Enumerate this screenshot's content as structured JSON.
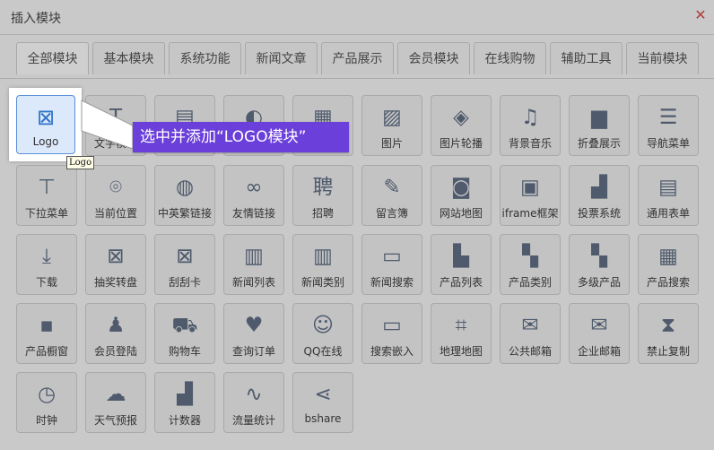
{
  "dialog": {
    "title": "插入模块",
    "close_icon": "close-icon"
  },
  "tabs": [
    "全部模块",
    "基本模块",
    "系统功能",
    "新闻文章",
    "产品展示",
    "会员模块",
    "在线购物",
    "辅助工具",
    "当前模块"
  ],
  "active_tab": "全部模块",
  "highlighted_module": {
    "label": "Logo",
    "icon": "logo-icon",
    "tooltip": "Logo"
  },
  "callout": {
    "text": "选中并添加“LOGO模块”",
    "color": "#6b3fd9"
  },
  "rows": [
    [
      {
        "label": "文字模块",
        "icon": "text-icon",
        "glyph": "T"
      },
      {
        "label": "",
        "icon": "image-text-icon",
        "glyph": "▤"
      },
      {
        "label": "",
        "icon": "flash-icon",
        "glyph": "◐"
      },
      {
        "label": "",
        "icon": "video-icon",
        "glyph": "▦"
      },
      {
        "label": "图片",
        "icon": "image-icon",
        "glyph": "▨"
      },
      {
        "label": "图片轮播",
        "icon": "slideshow-icon",
        "glyph": "◈"
      },
      {
        "label": "背景音乐",
        "icon": "music-icon",
        "glyph": "♫"
      },
      {
        "label": "折叠展示",
        "icon": "folder-icon",
        "glyph": "▆"
      },
      {
        "label": "导航菜单",
        "icon": "menu-icon",
        "glyph": "☰"
      }
    ],
    [
      {
        "label": "下拉菜单",
        "icon": "sitemap-icon",
        "glyph": "⊤"
      },
      {
        "label": "当前位置",
        "icon": "location-pin-icon",
        "glyph": "⌾"
      },
      {
        "label": "中英繁链接",
        "icon": "globe-icon",
        "glyph": "◍"
      },
      {
        "label": "友情链接",
        "icon": "link-icon",
        "glyph": "∞"
      },
      {
        "label": "招聘",
        "icon": "recruit-icon",
        "glyph": "聘"
      },
      {
        "label": "留言簿",
        "icon": "pencil-icon",
        "glyph": "✎"
      },
      {
        "label": "网站地图",
        "icon": "site-map-icon",
        "glyph": "◙"
      },
      {
        "label": "iframe框架",
        "icon": "iframe-icon",
        "glyph": "▣"
      },
      {
        "label": "投票系统",
        "icon": "vote-chart-icon",
        "glyph": "▟"
      },
      {
        "label": "通用表单",
        "icon": "form-icon",
        "glyph": "▤"
      }
    ],
    [
      {
        "label": "下载",
        "icon": "download-icon",
        "glyph": "⤓"
      },
      {
        "label": "抽奖转盘",
        "icon": "lottery-icon",
        "glyph": "⊠"
      },
      {
        "label": "刮刮卡",
        "icon": "scratch-card-icon",
        "glyph": "⊠"
      },
      {
        "label": "新闻列表",
        "icon": "news-list-icon",
        "glyph": "▥"
      },
      {
        "label": "新闻类别",
        "icon": "news-category-icon",
        "glyph": "▥"
      },
      {
        "label": "新闻搜索",
        "icon": "news-search-icon",
        "glyph": "▭"
      },
      {
        "label": "产品列表",
        "icon": "product-list-icon",
        "glyph": "▙"
      },
      {
        "label": "产品类别",
        "icon": "product-category-icon",
        "glyph": "▚"
      },
      {
        "label": "多级产品",
        "icon": "multilevel-product-icon",
        "glyph": "▚"
      },
      {
        "label": "产品搜索",
        "icon": "product-search-icon",
        "glyph": "▦"
      }
    ],
    [
      {
        "label": "产品橱窗",
        "icon": "showcase-icon",
        "glyph": "▪"
      },
      {
        "label": "会员登陆",
        "icon": "member-icon",
        "glyph": "♟"
      },
      {
        "label": "购物车",
        "icon": "cart-icon",
        "glyph": "⛟"
      },
      {
        "label": "查询订单",
        "icon": "order-query-icon",
        "glyph": "♥"
      },
      {
        "label": "QQ在线",
        "icon": "qq-icon",
        "glyph": "☺"
      },
      {
        "label": "搜索嵌入",
        "icon": "search-embed-icon",
        "glyph": "▭"
      },
      {
        "label": "地理地图",
        "icon": "map-icon",
        "glyph": "⌗"
      },
      {
        "label": "公共邮箱",
        "icon": "mail-icon",
        "glyph": "✉"
      },
      {
        "label": "企业邮箱",
        "icon": "enterprise-mail-icon",
        "glyph": "✉"
      },
      {
        "label": "禁止复制",
        "icon": "no-copy-icon",
        "glyph": "⧗"
      }
    ],
    [
      {
        "label": "时钟",
        "icon": "clock-icon",
        "glyph": "◷"
      },
      {
        "label": "天气预报",
        "icon": "weather-icon",
        "glyph": "☁"
      },
      {
        "label": "计数器",
        "icon": "counter-icon",
        "glyph": "▟"
      },
      {
        "label": "流量统计",
        "icon": "traffic-stats-icon",
        "glyph": "∿"
      },
      {
        "label": "bshare",
        "icon": "share-icon",
        "glyph": "⋖"
      }
    ]
  ]
}
